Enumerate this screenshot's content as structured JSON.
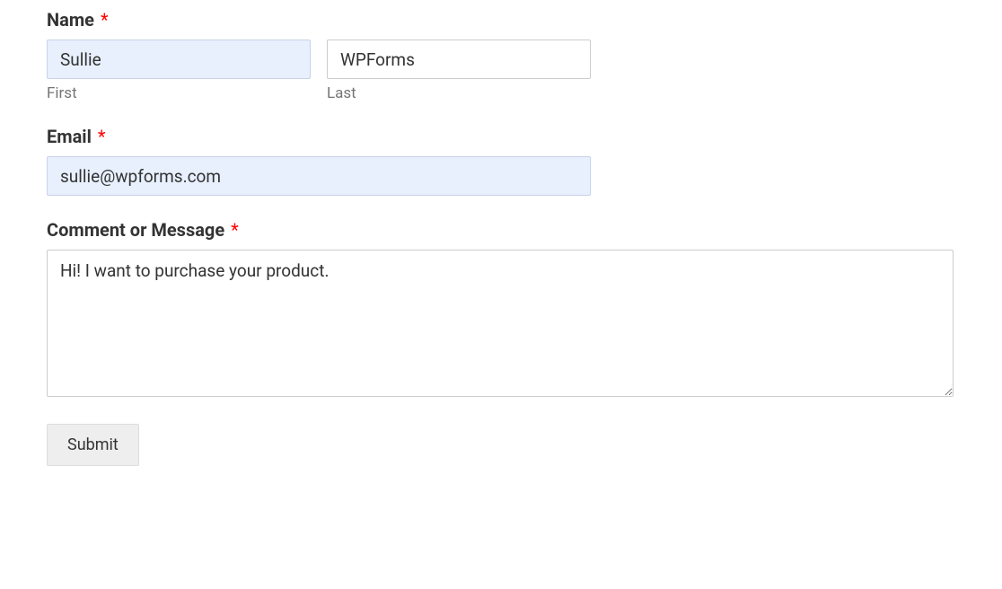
{
  "form": {
    "name": {
      "label": "Name",
      "required_marker": "*",
      "first": {
        "value": "Sullie",
        "sublabel": "First"
      },
      "last": {
        "value": "WPForms",
        "sublabel": "Last"
      }
    },
    "email": {
      "label": "Email",
      "required_marker": "*",
      "value": "sullie@wpforms.com"
    },
    "message": {
      "label": "Comment or Message",
      "required_marker": "*",
      "value": "Hi! I want to purchase your product."
    },
    "submit": {
      "label": "Submit"
    }
  }
}
